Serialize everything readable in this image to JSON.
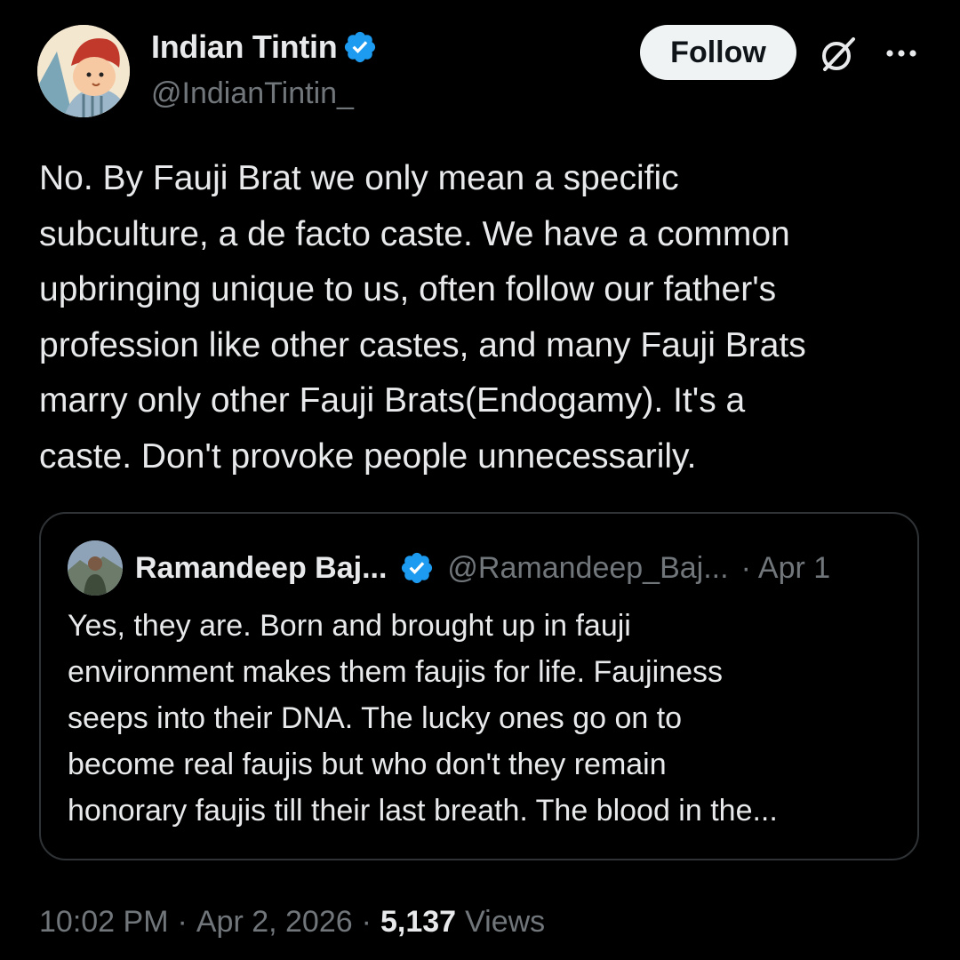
{
  "tweet": {
    "author": {
      "display_name": "Indian Tintin",
      "handle": "@IndianTintin_",
      "verified_icon": "verified-badge-icon",
      "avatar_icon": "tintin-cartoon-avatar"
    },
    "actions": {
      "follow_label": "Follow",
      "grok_icon": "grok-icon",
      "more_icon": "more-options-icon"
    },
    "text": "No. By Fauji Brat we only mean a specific\nsubculture, a de facto caste. We have a common\nupbringing unique to us, often follow our father's\nprofession like other castes, and many Fauji Brats\nmarry only other Fauji Brats(Endogamy). It's a\ncaste. Don't provoke people unnecessarily.",
    "quoted": {
      "display_name": "Ramandeep Baj...",
      "handle": "@Ramandeep_Baj...",
      "separator": "·",
      "date": "Apr 1",
      "text": "Yes, they are. Born and brought up in fauji\nenvironment makes them faujis for life. Faujiness\nseeps into their DNA. The lucky ones go on to\nbecome real faujis but who don't they remain\nhonorary faujis till their last breath. The blood in the..."
    },
    "meta": {
      "time": "10:02 PM",
      "separator_1": "·",
      "date": "Apr 2, 2026",
      "separator_2": "·",
      "views_count": "5,137",
      "views_label": "Views"
    }
  },
  "colors": {
    "background": "#000000",
    "text_primary": "#e7e9ea",
    "text_secondary": "#71767b",
    "verified_blue": "#1d9bf0",
    "border": "#2f3336",
    "follow_bg": "#eff3f4"
  }
}
